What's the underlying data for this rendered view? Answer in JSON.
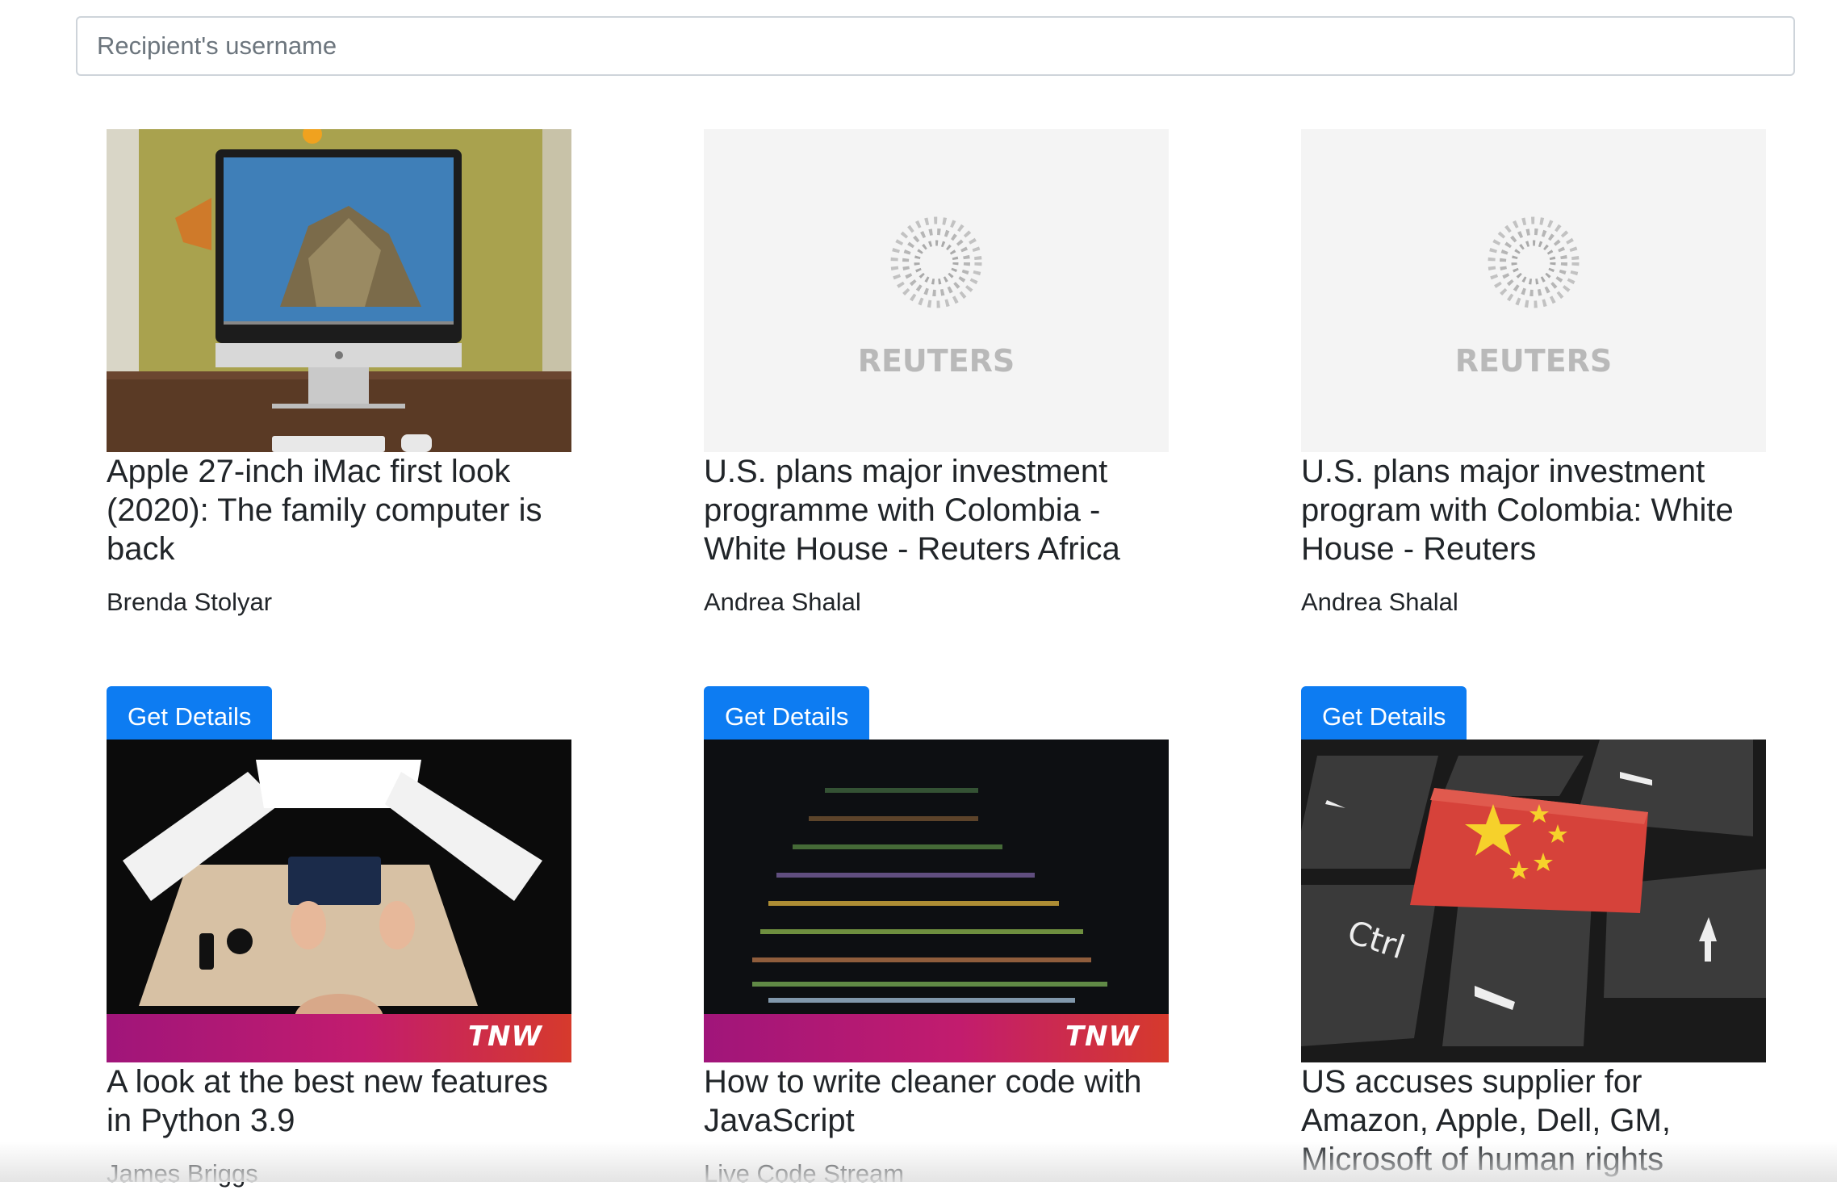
{
  "search": {
    "placeholder": "Recipient's username",
    "value": ""
  },
  "articles": [
    {
      "title": "Apple 27-inch iMac first look (2020): The family computer is back",
      "author": "Brenda Stolyar",
      "button": "Get Details"
    },
    {
      "title": "U.S. plans major investment programme with Colombia - White House - Reuters Africa",
      "author": "Andrea Shalal",
      "button": "Get Details",
      "image_text": "REUTERS"
    },
    {
      "title": "U.S. plans major investment program with Colombia: White House - Reuters",
      "author": "Andrea Shalal",
      "button": "Get Details",
      "image_text": "REUTERS"
    },
    {
      "title": "A look at the best new features in Python 3.9",
      "author": "James Briggs",
      "image_text": "TNW"
    },
    {
      "title": "How to write cleaner code with JavaScript",
      "author": "Live Code Stream",
      "image_text": "TNW"
    },
    {
      "title": "US accuses supplier for Amazon, Apple, Dell, GM, Microsoft of human rights",
      "image_text": "Ctrl"
    }
  ],
  "colors": {
    "primary_button": "#0d7cf2",
    "input_border": "#ced4da"
  }
}
